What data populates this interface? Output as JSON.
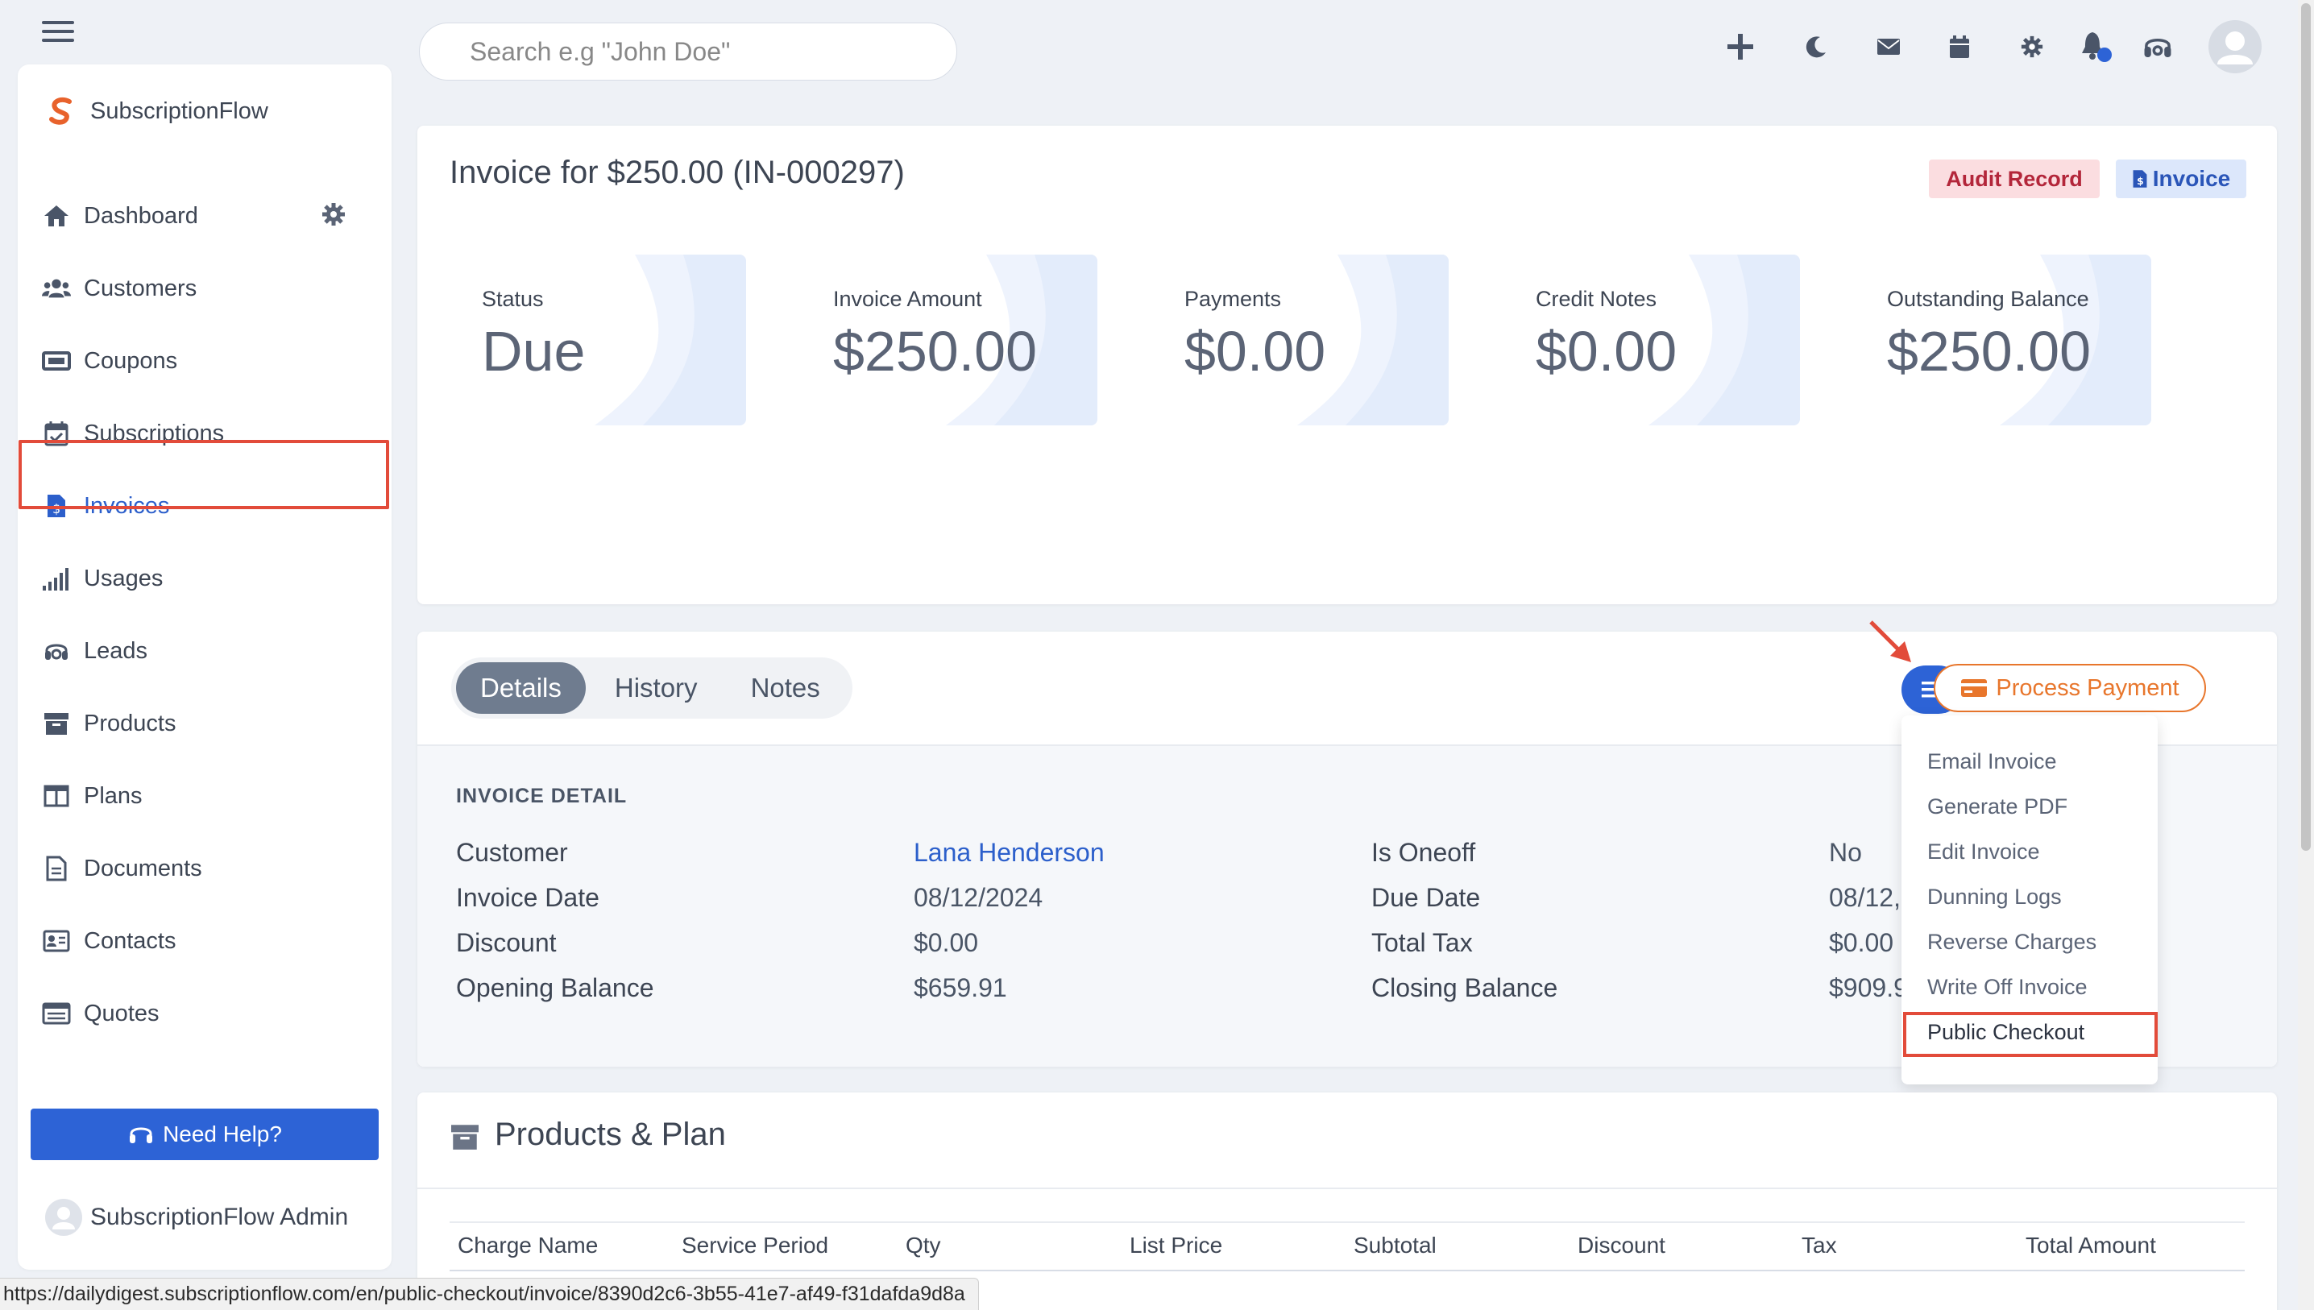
{
  "brand": {
    "name": "SubscriptionFlow"
  },
  "sidebar": {
    "items": [
      {
        "label": "Dashboard",
        "icon": "home-icon"
      },
      {
        "label": "Customers",
        "icon": "users-icon"
      },
      {
        "label": "Coupons",
        "icon": "ticket-icon"
      },
      {
        "label": "Subscriptions",
        "icon": "calendar-check-icon"
      },
      {
        "label": "Invoices",
        "icon": "invoice-icon",
        "active": true
      },
      {
        "label": "Usages",
        "icon": "signal-bars-icon"
      },
      {
        "label": "Leads",
        "icon": "headset-icon"
      },
      {
        "label": "Products",
        "icon": "archive-box-icon"
      },
      {
        "label": "Plans",
        "icon": "columns-icon"
      },
      {
        "label": "Documents",
        "icon": "document-icon"
      },
      {
        "label": "Contacts",
        "icon": "contact-card-icon"
      },
      {
        "label": "Quotes",
        "icon": "list-card-icon"
      }
    ],
    "help_label": "Need Help?",
    "user_name": "SubscriptionFlow Admin"
  },
  "topbar": {
    "search_placeholder": "Search e.g \"John Doe\""
  },
  "invoice": {
    "title": "Invoice for $250.00 (IN-000297)",
    "badge_audit": "Audit Record",
    "badge_invoice": "Invoice",
    "stats": [
      {
        "label": "Status",
        "value": "Due"
      },
      {
        "label": "Invoice Amount",
        "value": "$250.00"
      },
      {
        "label": "Payments",
        "value": "$0.00"
      },
      {
        "label": "Credit Notes",
        "value": "$0.00"
      },
      {
        "label": "Outstanding Balance",
        "value": "$250.00"
      }
    ]
  },
  "tabs": [
    "Details",
    "History",
    "Notes"
  ],
  "active_tab": "Details",
  "process_payment_label": "Process Payment",
  "detail": {
    "section_title": "INVOICE DETAIL",
    "left": [
      {
        "label": "Customer",
        "value": "Lana Henderson"
      },
      {
        "label": "Invoice Date",
        "value": "08/12/2024"
      },
      {
        "label": "Discount",
        "value": "$0.00"
      },
      {
        "label": "Opening Balance",
        "value": "$659.91"
      }
    ],
    "right": [
      {
        "label": "Is Oneoff",
        "value": "No"
      },
      {
        "label": "Due Date",
        "value": "08/12,"
      },
      {
        "label": "Total Tax",
        "value": "$0.00"
      },
      {
        "label": "Closing Balance",
        "value": "$909.9"
      }
    ]
  },
  "actions_menu": [
    "Email Invoice",
    "Generate PDF",
    "Edit Invoice",
    "Dunning Logs",
    "Reverse Charges",
    "Write Off Invoice",
    "Public Checkout"
  ],
  "products": {
    "title": "Products & Plan",
    "columns": [
      "Charge Name",
      "Service Period",
      "Qty",
      "List Price",
      "Subtotal",
      "Discount",
      "Tax",
      "Total Amount"
    ]
  },
  "status_url": "https://dailydigest.subscriptionflow.com/en/public-checkout/invoice/8390d2c6-3b55-41e7-af49-f31dafda9d8a",
  "colors": {
    "accent": "#2d63d6",
    "highlight": "#e24b3a",
    "process_payment": "#e8762c"
  }
}
